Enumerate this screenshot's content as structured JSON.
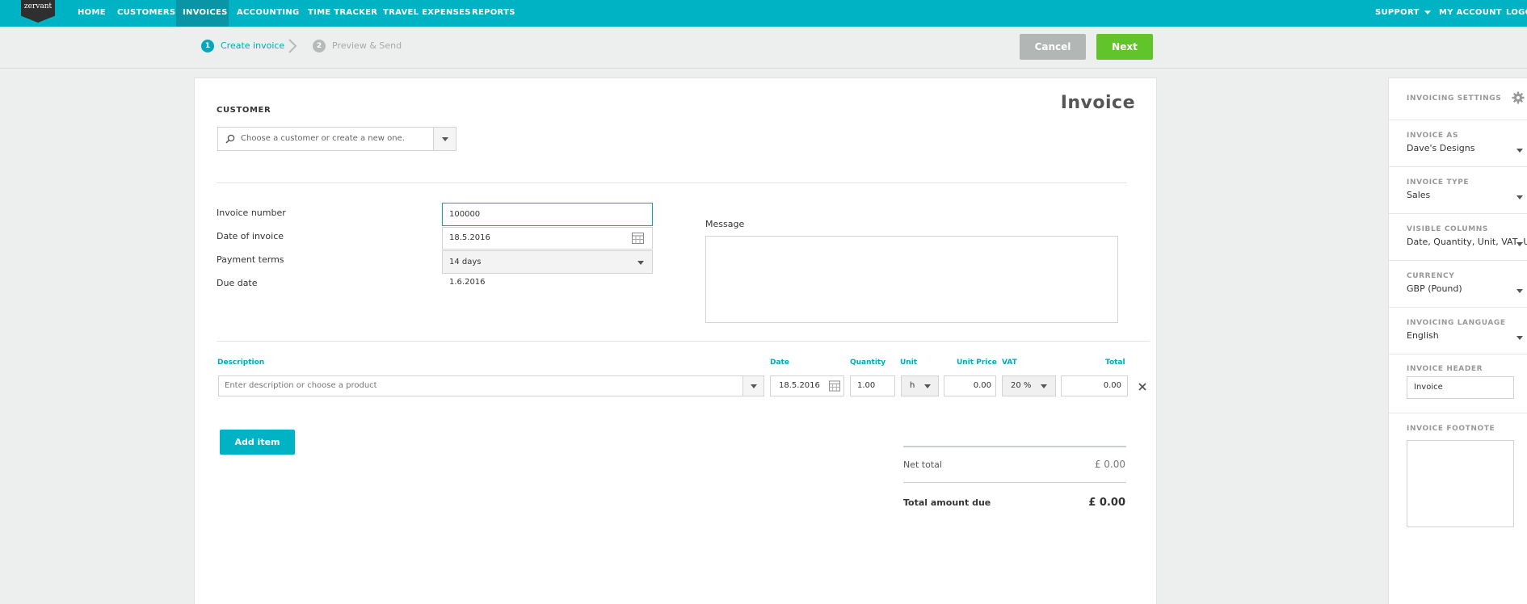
{
  "app": {
    "logo_text": "zervant"
  },
  "nav": {
    "items": [
      "HOME",
      "CUSTOMERS",
      "INVOICES",
      "ACCOUNTING",
      "TIME TRACKER",
      "TRAVEL EXPENSES",
      "REPORTS"
    ],
    "active": "INVOICES",
    "right": [
      "SUPPORT",
      "MY ACCOUNT",
      "LOGO"
    ]
  },
  "steps": [
    {
      "num": "1",
      "label": "Create invoice"
    },
    {
      "num": "2",
      "label": "Preview & Send"
    }
  ],
  "actions": {
    "cancel": "Cancel",
    "next": "Next"
  },
  "invoice": {
    "title": "Invoice",
    "customer_label": "CUSTOMER",
    "customer_placeholder": "Choose a customer or create a new one.",
    "fields": {
      "number_label": "Invoice number",
      "number_value": "100000",
      "date_label": "Date of invoice",
      "date_value": "18.5.2016",
      "terms_label": "Payment terms",
      "terms_value": "14 days",
      "due_label": "Due date",
      "due_value": "1.6.2016"
    },
    "message_label": "Message",
    "columns": {
      "description": "Description",
      "date": "Date",
      "quantity": "Quantity",
      "unit": "Unit",
      "unit_price": "Unit Price",
      "vat": "VAT",
      "total": "Total"
    },
    "row": {
      "description_placeholder": "Enter description or choose a product",
      "date": "18.5.2016",
      "quantity": "1.00",
      "unit": "h",
      "unit_price": "0.00",
      "vat": "20 %",
      "total": "0.00"
    },
    "add_item": "Add item",
    "totals": {
      "net_label": "Net total",
      "net_value": "£ 0.00",
      "due_label": "Total amount due",
      "due_value": "£ 0.00"
    }
  },
  "settings": {
    "title": "INVOICING SETTINGS",
    "invoice_as_label": "INVOICE AS",
    "invoice_as_value": "Dave's Designs",
    "type_label": "INVOICE TYPE",
    "type_value": "Sales",
    "columns_label": "VISIBLE COLUMNS",
    "columns_value": "Date, Quantity, Unit, VAT, U",
    "currency_label": "CURRENCY",
    "currency_value": "GBP (Pound)",
    "language_label": "INVOICING LANGUAGE",
    "language_value": "English",
    "header_label": "INVOICE HEADER",
    "header_value": "Invoice",
    "footnote_label": "INVOICE FOOTNOTE"
  }
}
